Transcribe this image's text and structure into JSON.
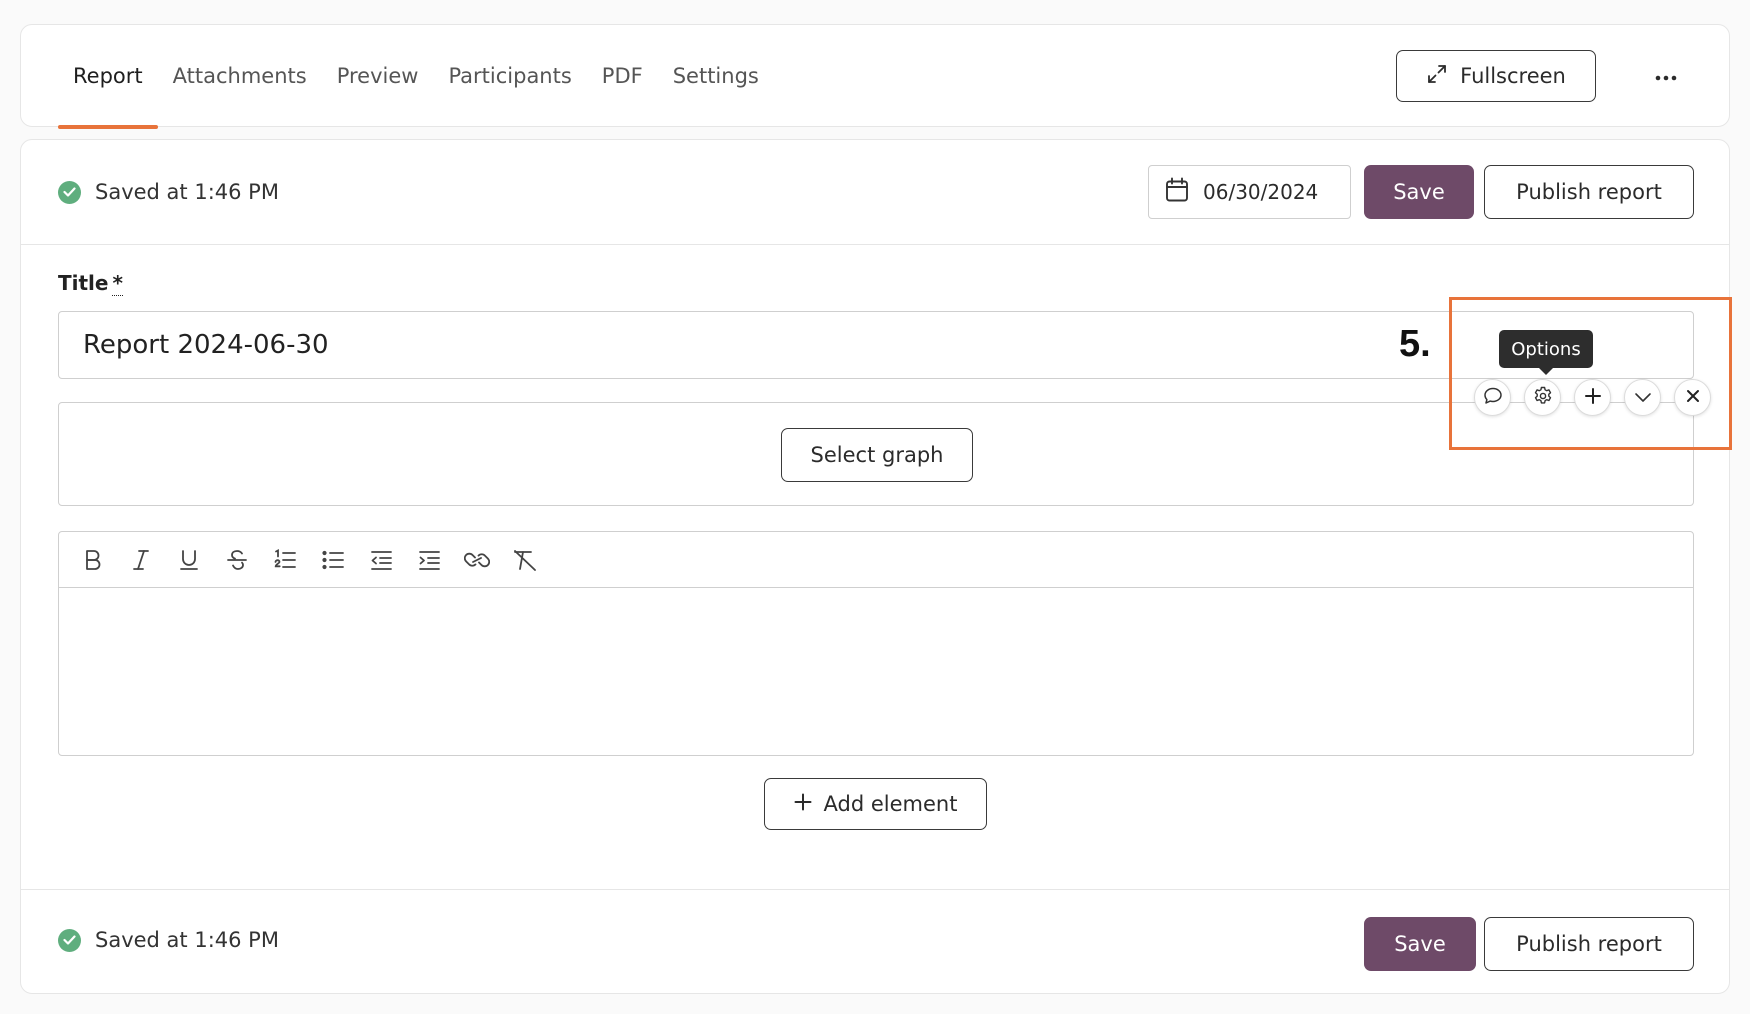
{
  "tabs": [
    {
      "label": "Report",
      "active": true
    },
    {
      "label": "Attachments",
      "active": false
    },
    {
      "label": "Preview",
      "active": false
    },
    {
      "label": "Participants",
      "active": false
    },
    {
      "label": "PDF",
      "active": false
    },
    {
      "label": "Settings",
      "active": false
    }
  ],
  "header": {
    "fullscreen_label": "Fullscreen",
    "more_icon": "more-horizontal-icon"
  },
  "status": {
    "top_text": "Saved at 1:46 PM",
    "bottom_text": "Saved at 1:46 PM",
    "icon": "check-circle-icon"
  },
  "date": {
    "value": "06/30/2024",
    "icon": "calendar-icon"
  },
  "actions": {
    "save_label": "Save",
    "publish_label": "Publish report"
  },
  "title_field": {
    "label": "Title",
    "required_marker": "*",
    "value": "Report 2024-06-30"
  },
  "graph_block": {
    "select_label": "Select graph"
  },
  "editor_toolbar": [
    "bold-icon",
    "italic-icon",
    "underline-icon",
    "strikethrough-icon",
    "ordered-list-icon",
    "bullet-list-icon",
    "outdent-icon",
    "indent-icon",
    "link-icon",
    "clear-format-icon"
  ],
  "add_element_label": "Add element",
  "block_toolbar": {
    "tooltip": "Options",
    "step_label": "5.",
    "buttons": [
      "comment-icon",
      "gear-icon",
      "plus-icon",
      "chevron-down-icon",
      "close-icon"
    ]
  },
  "colors": {
    "accent": "#e8733a",
    "primary": "#6e4a68",
    "success": "#5fae7e"
  }
}
